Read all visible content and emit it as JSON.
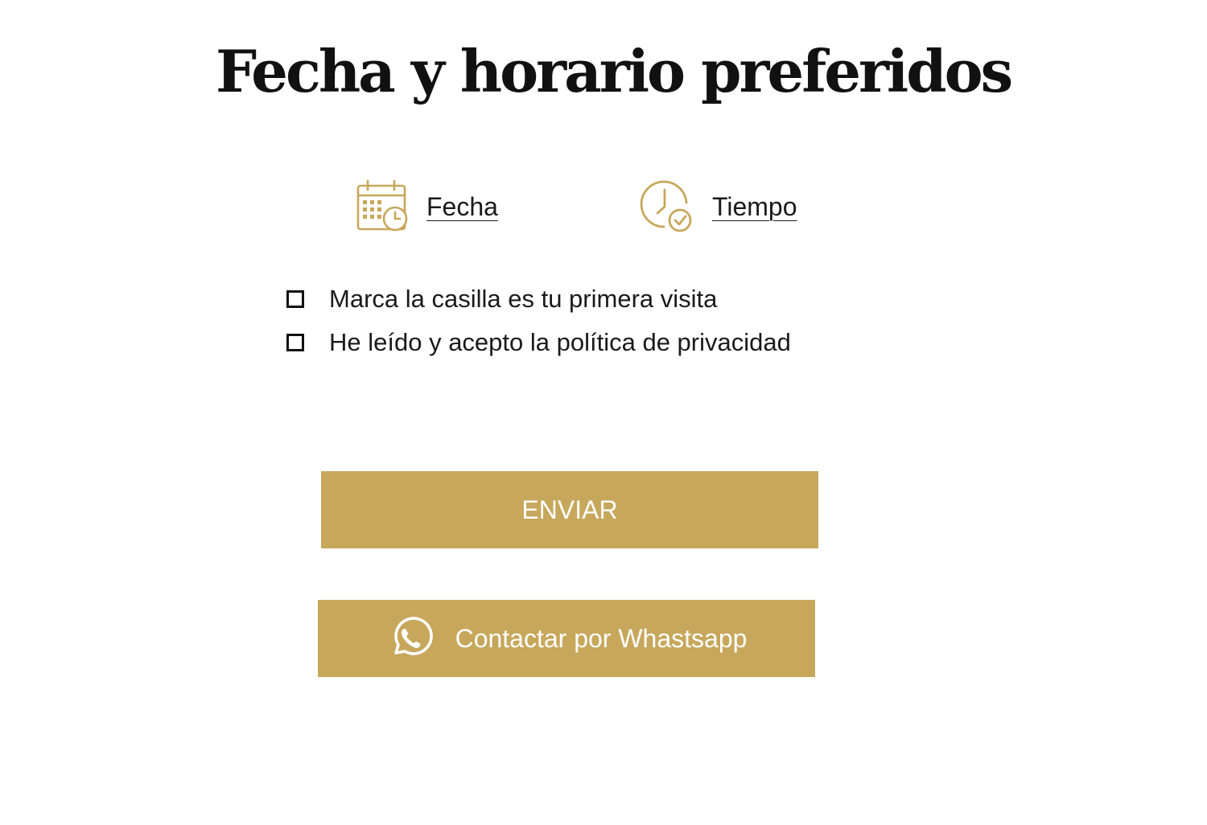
{
  "header": {
    "title": "Fecha y horario preferidos"
  },
  "pickers": {
    "date": {
      "label": "Fecha",
      "icon": "calendar-clock-icon"
    },
    "time": {
      "label": "Tiempo",
      "icon": "clock-check-icon"
    }
  },
  "checkboxes": [
    {
      "label": "Marca la casilla es tu primera visita",
      "checked": false
    },
    {
      "label": "He leído y acepto la política de privacidad",
      "checked": false
    }
  ],
  "actions": {
    "send_label": "ENVIAR",
    "whatsapp_label": "Contactar por Whastsapp",
    "whatsapp_icon": "whatsapp-icon"
  },
  "colors": {
    "accent": "#c7a75b",
    "text": "#1a1a1a",
    "background": "#ffffff"
  }
}
